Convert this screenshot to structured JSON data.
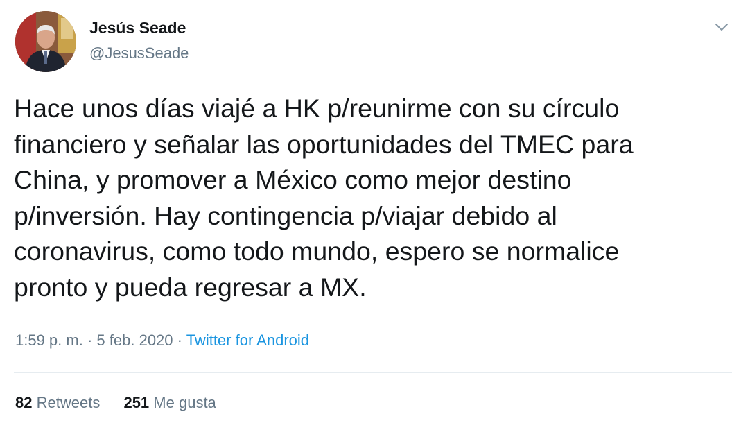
{
  "author": {
    "name": "Jesús Seade",
    "handle": "@JesusSeade"
  },
  "tweet": {
    "text": "Hace unos días viajé a HK p/reunirme con su círculo\nfinanciero y señalar las oportunidades del TMEC para\nChina, y promover a México como mejor destino\np/inversión. Hay contingencia p/viajar debido al\ncoronavirus, como todo mundo, espero se normalice\npronto y pueda regresar a MX.",
    "time": "1:59 p. m.",
    "separator": "·",
    "date": "5 feb. 2020",
    "source": "Twitter for Android"
  },
  "stats": {
    "retweets_count": "82",
    "retweets_label": "Retweets",
    "likes_count": "251",
    "likes_label": "Me gusta"
  },
  "icons": {
    "menu": "chevron-down-icon"
  },
  "colors": {
    "text": "#14171a",
    "secondary": "#657786",
    "link": "#1b95e0",
    "divider": "#e6ecf0"
  }
}
